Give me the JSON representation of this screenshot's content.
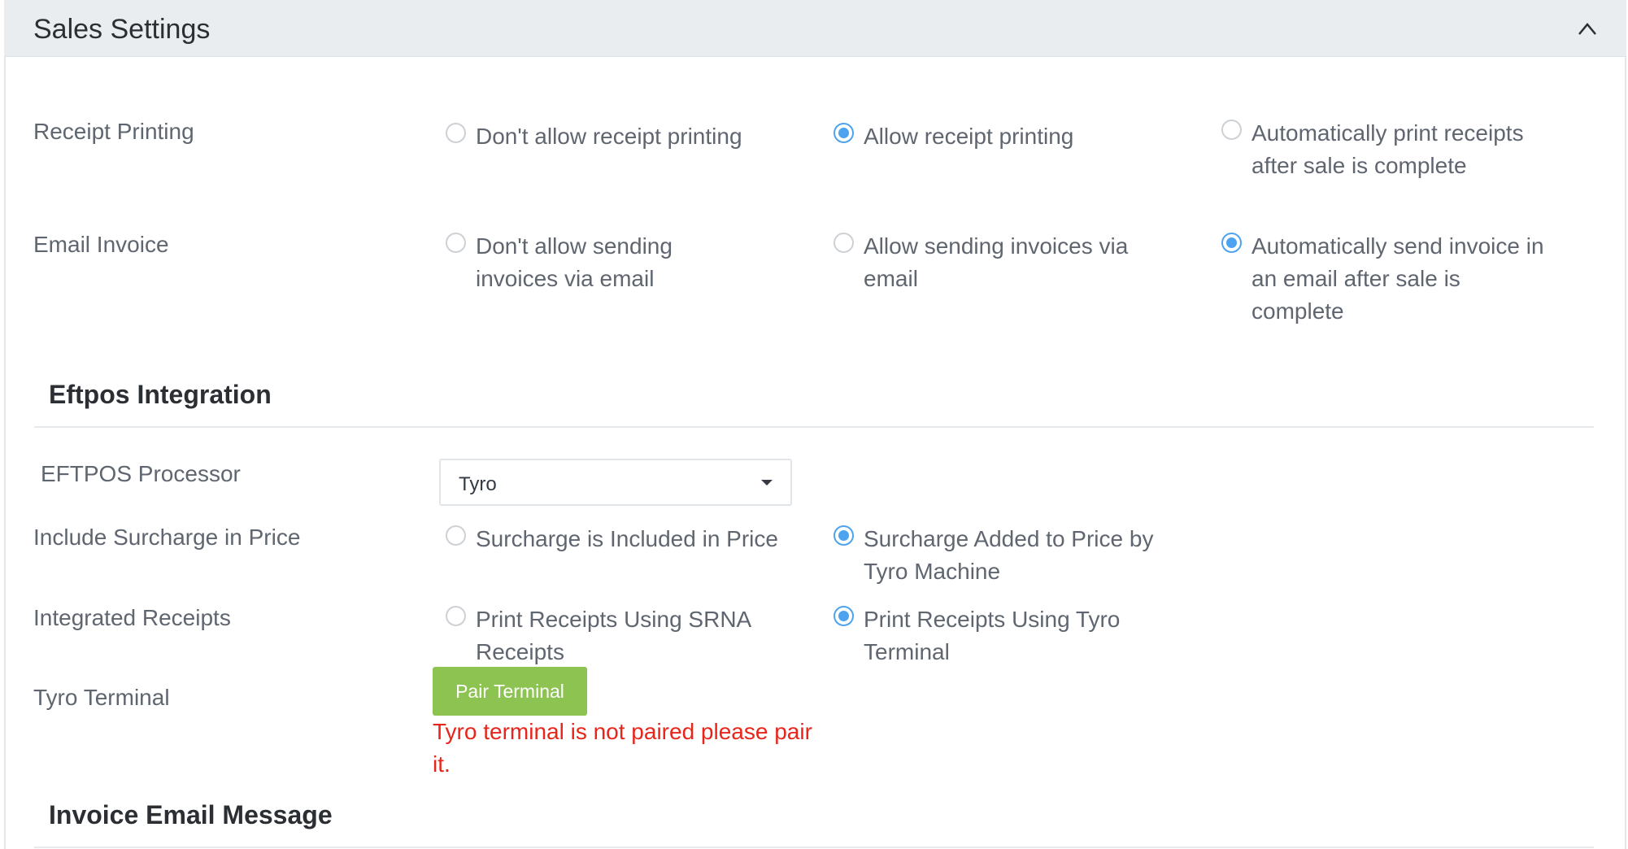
{
  "panel": {
    "title": "Sales Settings",
    "collapse_icon": "chevron-up-icon"
  },
  "receipt_printing": {
    "label": "Receipt Printing",
    "options": [
      {
        "text": "Don't allow receipt printing",
        "selected": false
      },
      {
        "text": "Allow receipt printing",
        "selected": true
      },
      {
        "text": "Automatically print receipts after sale is complete",
        "selected": false
      }
    ]
  },
  "email_invoice": {
    "label": "Email Invoice",
    "options": [
      {
        "text": "Don't allow sending invoices via email",
        "selected": false
      },
      {
        "text": "Allow sending invoices via email",
        "selected": false
      },
      {
        "text": "Automatically send invoice in an email after sale is complete",
        "selected": true
      }
    ]
  },
  "eftpos": {
    "title": "Eftpos Integration",
    "processor": {
      "label": "EFTPOS Processor",
      "value": "Tyro"
    },
    "surcharge": {
      "label": "Include Surcharge in Price",
      "options": [
        {
          "text": "Surcharge is Included in Price",
          "selected": false
        },
        {
          "text": "Surcharge Added to Price by Tyro Machine",
          "selected": true
        }
      ]
    },
    "integrated_receipts": {
      "label": "Integrated Receipts",
      "options": [
        {
          "text": "Print Receipts Using SRNA Receipts",
          "selected": false
        },
        {
          "text": "Print Receipts Using Tyro Terminal",
          "selected": true
        }
      ]
    },
    "terminal": {
      "label": "Tyro Terminal",
      "button": "Pair Terminal",
      "error": "Tyro terminal is not paired please pair it."
    }
  },
  "invoice_email": {
    "title": "Invoice Email Message"
  },
  "colors": {
    "accent": "#4da3f0",
    "button": "#8cc351",
    "error": "#e8251b",
    "header_bg": "#e9edf0"
  }
}
